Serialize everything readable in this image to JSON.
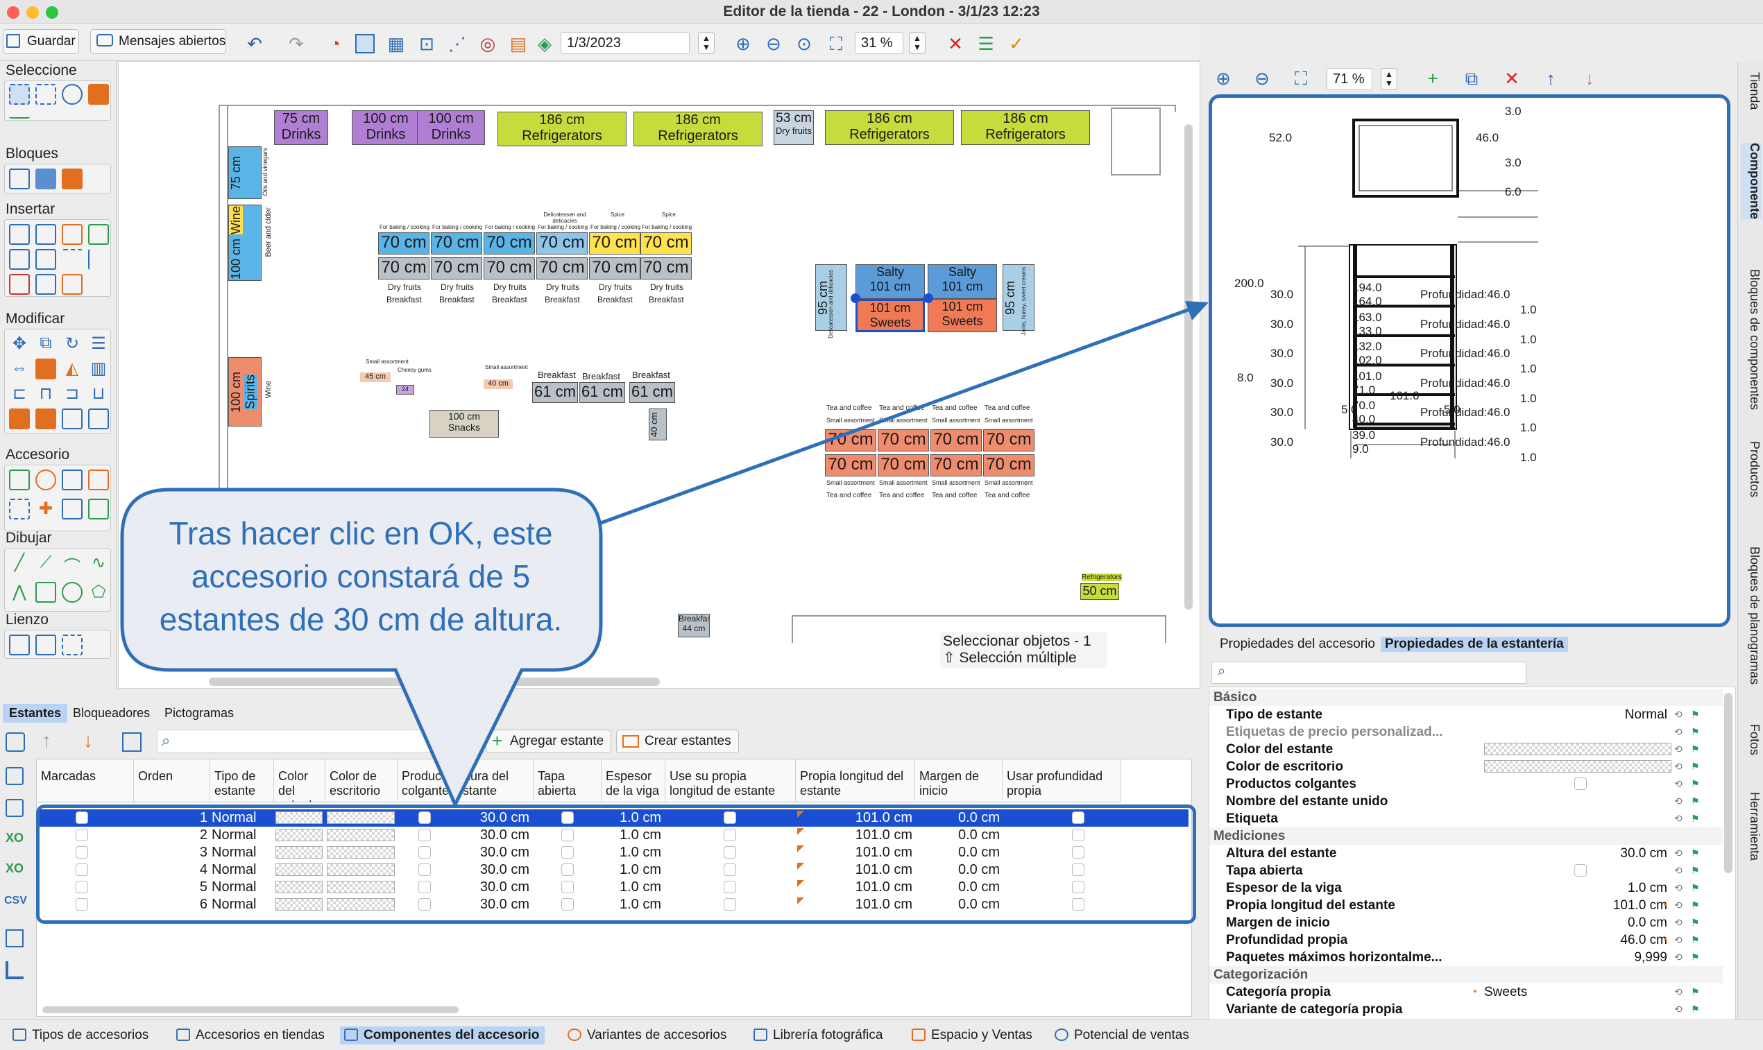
{
  "window": {
    "title": "Editor de la tienda - 22 - London - 3/1/23 12:23"
  },
  "toolbar": {
    "save": "Guardar",
    "messages": "Mensajes abiertos",
    "date": "1/3/2023",
    "zoom": "31 %"
  },
  "left_panel": {
    "sections": [
      "Seleccione",
      "Bloques",
      "Insertar",
      "Modificar",
      "Accesorio",
      "Dibujar",
      "Lienzo"
    ]
  },
  "canvas": {
    "fixtures_top": [
      {
        "size": "75 cm",
        "name": "Drinks"
      },
      {
        "size": "100 cm",
        "name": "Drinks"
      },
      {
        "size": "100 cm",
        "name": "Drinks"
      },
      {
        "size": "186 cm",
        "name": "Refrigerators"
      },
      {
        "size": "186 cm",
        "name": "Refrigerators"
      },
      {
        "size": "53 cm",
        "name": "Dry fruits"
      },
      {
        "size": "186 cm",
        "name": "Refrigerators"
      },
      {
        "size": "186 cm",
        "name": "Refrigerators"
      }
    ],
    "left_fixtures": [
      {
        "size": "75 cm",
        "name": "For baking / cooking",
        "sub": "Oils and vinegars"
      },
      {
        "size": "100 cm",
        "name": "Wine",
        "sub": "Beer and cider"
      },
      {
        "size": "100 cm",
        "name": "Spirits",
        "sub": "Wine"
      }
    ],
    "gondola_top_labels": [
      "For baking / cooking",
      "For baking / cooking",
      "For baking / cooking",
      "For baking / cooking",
      "For baking / cooking",
      "For baking / cooking"
    ],
    "gondola_top_labels2": [
      "",
      "",
      "",
      "Delicatessen and delicacies",
      "Spice",
      "Spice"
    ],
    "gondola_size": "70 cm",
    "gondola_bottom_labels": [
      "Dry fruits",
      "Dry fruits",
      "Dry fruits",
      "Dry fruits",
      "Dry fruits",
      "Dry fruits"
    ],
    "gondola_bottom_labels2": [
      "Breakfast",
      "Breakfast",
      "Breakfast",
      "Breakfast",
      "Breakfast",
      "Breakfast"
    ],
    "salty": [
      {
        "name": "Salty",
        "size": "101 cm"
      },
      {
        "name": "Salty",
        "size": "101 cm"
      }
    ],
    "sweets": [
      {
        "size": "101 cm",
        "name": "Sweets"
      },
      {
        "size": "101 cm",
        "name": "Sweets"
      }
    ],
    "side95": [
      {
        "size": "95 cm",
        "name": "Delicatessen and delicacies"
      },
      {
        "size": "95 cm",
        "name": "Jams, honey, sweet creams"
      }
    ],
    "small": [
      {
        "label": "Small assortment",
        "size": "45 cm"
      },
      {
        "label": "Cheesy gums",
        "size": "24 cm"
      },
      {
        "label": "Small assortment",
        "size": "40 cm"
      }
    ],
    "snacks": {
      "size": "100 cm",
      "name": "Snacks"
    },
    "breakfast_labels": [
      "Breakfast",
      "Breakfast",
      "Breakfast"
    ],
    "breakfast_size": "61 cm",
    "breakfast_side": "40 cm",
    "tea_top": [
      "Tea and coffee",
      "Tea and coffee",
      "Tea and coffee",
      "Tea and coffee"
    ],
    "tea_small": "Small assortment",
    "tea_size": "70 cm",
    "fridge_small": {
      "name": "Refrigerators",
      "size": "50 cm"
    },
    "breakfast_bottom": {
      "name": "Breakfast",
      "size": "44 cm"
    },
    "hint1": "Seleccionar objetos - 1",
    "hint2": "⇧ Selección múltiple"
  },
  "callout": "Tras hacer clic en OK, este accesorio constará de 5 estantes de 30 cm de altura.",
  "right_toolbar": {
    "zoom": "71 %"
  },
  "preview": {
    "top_dims": {
      "left": "52.0",
      "right": "46.0",
      "t1": "3.0",
      "t2": "3.0",
      "t3": "6.0"
    },
    "total_height": "200.0",
    "base": "8.0",
    "width": "101.0",
    "foot_l": "5.0",
    "foot_r": "5.0",
    "shelves": [
      {
        "top": "194.0",
        "bottom": "164.0",
        "left": "30.0",
        "right": "1.0",
        "depth": "Profundidad:46.0"
      },
      {
        "top": "163.0",
        "bottom": "133.0",
        "left": "30.0",
        "right": "1.0",
        "depth": "Profundidad:46.0"
      },
      {
        "top": "132.0",
        "bottom": "102.0",
        "left": "30.0",
        "right": "1.0",
        "depth": "Profundidad:46.0"
      },
      {
        "top": "101.0",
        "bottom": "71.0",
        "left": "30.0",
        "right": "1.0",
        "depth": "Profundidad:46.0"
      },
      {
        "top": "70.0",
        "bottom": "40.0",
        "left": "30.0",
        "right": "1.0",
        "depth": "Profundidad:46.0"
      },
      {
        "top": "39.0",
        "bottom": "9.0",
        "left": "30.0",
        "right": "1.0",
        "depth": "Profundidad:46.0"
      }
    ]
  },
  "side_tabs": [
    "Tienda",
    "Componente",
    "Bloques de componentes",
    "Productos",
    "Bloques de planogramas",
    "Fotos",
    "Herramienta"
  ],
  "props_tabs": [
    "Propiedades del accesorio",
    "Propiedades de la estantería"
  ],
  "properties": [
    {
      "cat": "Básico"
    },
    {
      "k": "Tipo de estante",
      "v": "Normal"
    },
    {
      "k": "Etiquetas de precio personalizad...",
      "v": "",
      "muted": true
    },
    {
      "k": "Color del estante",
      "v": "",
      "swatch": true
    },
    {
      "k": "Color de escritorio",
      "v": "",
      "swatch": true
    },
    {
      "k": "Productos colgantes",
      "v": "",
      "check": true
    },
    {
      "k": "Nombre del estante unido",
      "v": ""
    },
    {
      "k": "Etiqueta",
      "v": ""
    },
    {
      "cat": "Mediciones"
    },
    {
      "k": "Altura del estante",
      "v": "30.0 cm"
    },
    {
      "k": "Tapa abierta",
      "v": "",
      "check": true
    },
    {
      "k": "Espesor de la viga",
      "v": "1.0 cm"
    },
    {
      "k": "Propia longitud del estante",
      "v": "101.0 cm",
      "orange": true
    },
    {
      "k": "Margen de inicio",
      "v": "0.0 cm"
    },
    {
      "k": "Profundidad propia",
      "v": "46.0 cm",
      "orange": true
    },
    {
      "k": "Paquetes máximos horizontalme...",
      "v": "9,999"
    },
    {
      "cat": "Categorización"
    },
    {
      "k": "Categoría propia",
      "v": "Sweets",
      "orange": true,
      "left": true
    },
    {
      "k": "Variante de categoría propia",
      "v": ""
    }
  ],
  "bottom_tabs": [
    "Estantes",
    "Bloqueadores",
    "Pictogramas"
  ],
  "grid_buttons": {
    "add": "Agregar estante",
    "create": "Crear estantes"
  },
  "grid_headers": [
    "Marcadas",
    "Orden",
    "Tipo de estante",
    "Color del estante",
    "Color de escritorio",
    "Productos colgante",
    "Altura del estante",
    "Tapa abierta",
    "Espesor de la viga",
    "Use su propia longitud de estante",
    "Propia longitud del estante",
    "Margen de inicio",
    "Usar profundidad propia"
  ],
  "grid_rows": [
    {
      "order": "1",
      "type": "Normal",
      "height": "30.0 cm",
      "beam": "1.0 cm",
      "len": "101.0 cm",
      "margin": "0.0 cm"
    },
    {
      "order": "2",
      "type": "Normal",
      "height": "30.0 cm",
      "beam": "1.0 cm",
      "len": "101.0 cm",
      "margin": "0.0 cm"
    },
    {
      "order": "3",
      "type": "Normal",
      "height": "30.0 cm",
      "beam": "1.0 cm",
      "len": "101.0 cm",
      "margin": "0.0 cm"
    },
    {
      "order": "4",
      "type": "Normal",
      "height": "30.0 cm",
      "beam": "1.0 cm",
      "len": "101.0 cm",
      "margin": "0.0 cm"
    },
    {
      "order": "5",
      "type": "Normal",
      "height": "30.0 cm",
      "beam": "1.0 cm",
      "len": "101.0 cm",
      "margin": "0.0 cm"
    },
    {
      "order": "6",
      "type": "Normal",
      "height": "30.0 cm",
      "beam": "1.0 cm",
      "len": "101.0 cm",
      "margin": "0.0 cm"
    }
  ],
  "status_tabs": [
    "Tipos de accesorios",
    "Accesorios en tiendas",
    "Componentes del accesorio",
    "Variantes de accesorios",
    "Librería fotográfica",
    "Espacio y Ventas",
    "Potencial de ventas"
  ],
  "colors": {
    "accent": "#2f6fb8",
    "selection": "#1b4fd1",
    "drinks": "#b07fd3",
    "fridge": "#c6dc3c",
    "blue": "#5ab4e6",
    "yellow": "#ffe14d",
    "salmon": "#f08c6e",
    "grey": "#b8c0c8"
  }
}
